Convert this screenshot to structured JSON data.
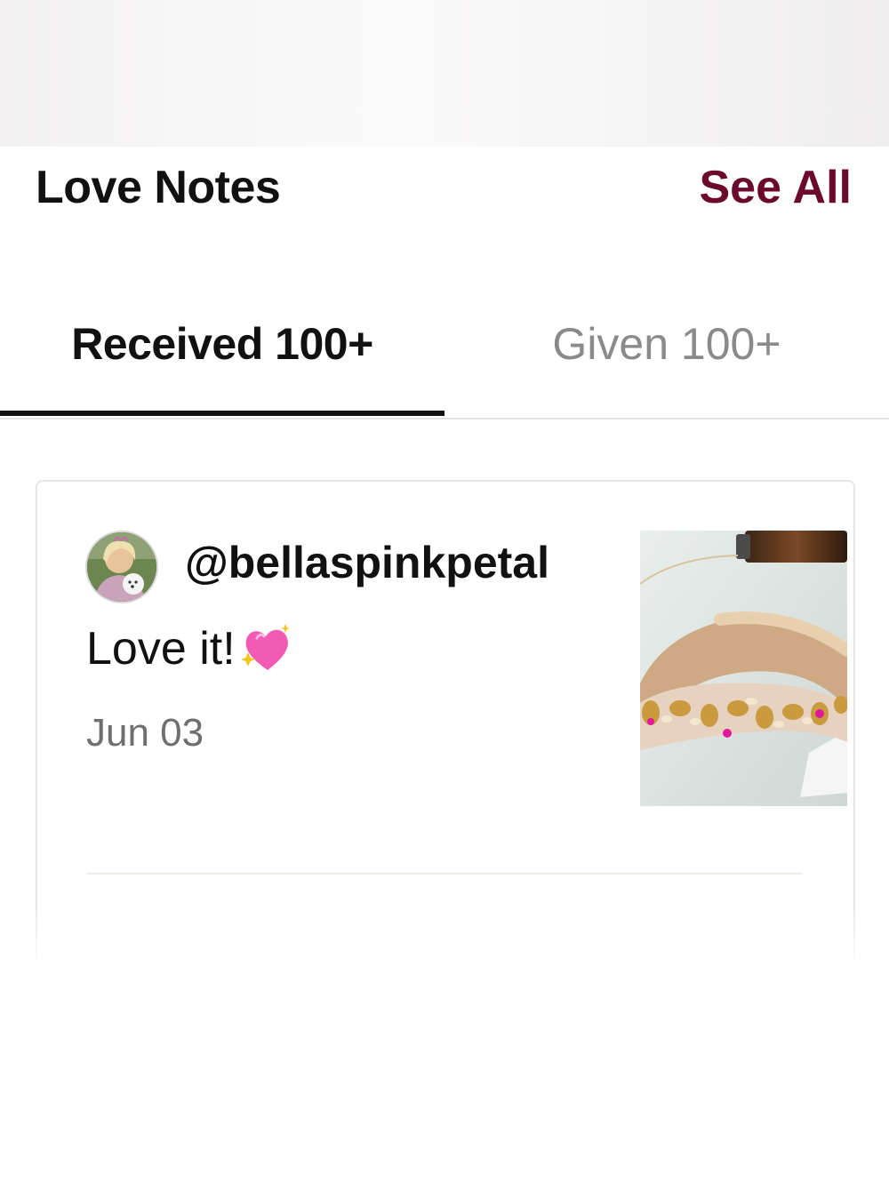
{
  "section": {
    "title": "Love Notes",
    "see_all_label": "See All"
  },
  "tabs": [
    {
      "label": "Received 100+",
      "active": true
    },
    {
      "label": "Given 100+",
      "active": false
    }
  ],
  "note": {
    "username": "@bellaspinkpetal",
    "message": "Love it!",
    "emoji_icon": "sparkling-heart-icon",
    "date": "Jun 03"
  },
  "colors": {
    "accent": "#6b0a2c",
    "text_primary": "#111111",
    "text_muted": "#8a8a8a"
  }
}
